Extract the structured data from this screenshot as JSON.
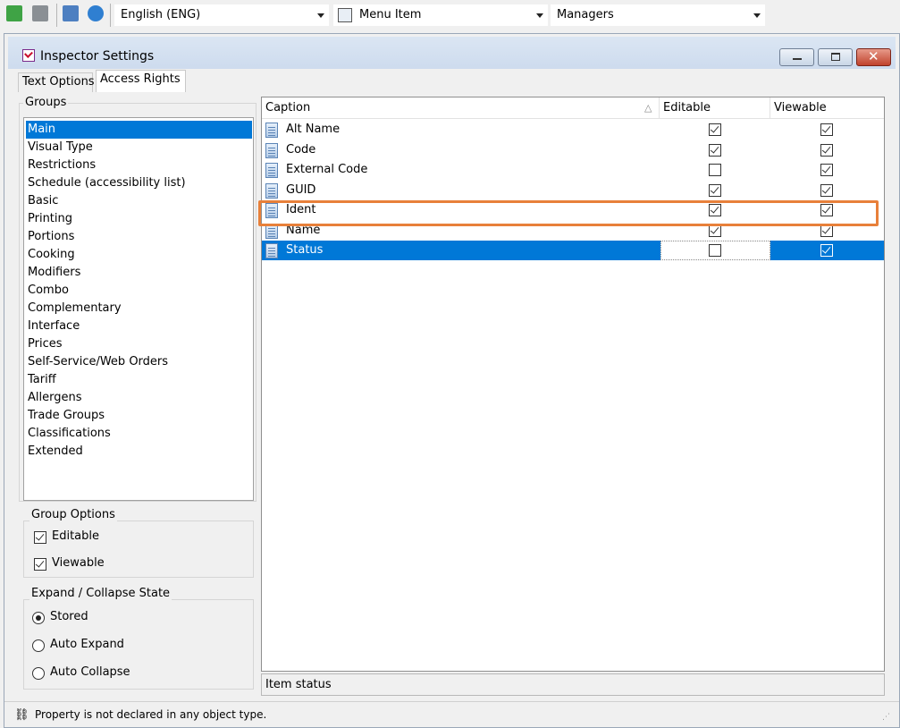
{
  "toolbar": {
    "language": "English (ENG)",
    "object_type": "Menu Item",
    "role": "Managers"
  },
  "window": {
    "title": "Inspector Settings"
  },
  "tabs": [
    "Text Options",
    "Access Rights"
  ],
  "groups": {
    "label": "Groups",
    "items": [
      "Main",
      "Visual Type",
      "Restrictions",
      "Schedule (accessibility list)",
      "Basic",
      "Printing",
      "Portions",
      "Cooking",
      "Modifiers",
      "Combo",
      "Complementary",
      "Interface",
      "Prices",
      "Self-Service/Web Orders",
      "Tariff",
      "Allergens",
      "Trade Groups",
      "Classifications",
      "Extended"
    ],
    "selected": "Main"
  },
  "group_options": {
    "label": "Group Options",
    "editable_label": "Editable",
    "viewable_label": "Viewable",
    "editable_checked": true,
    "viewable_checked": true
  },
  "expand_state": {
    "label": "Expand / Collapse State",
    "options": [
      "Stored",
      "Auto Expand",
      "Auto Collapse"
    ],
    "selected": "Stored"
  },
  "grid": {
    "columns": {
      "caption": "Caption",
      "editable": "Editable",
      "viewable": "Viewable"
    },
    "rows": [
      {
        "caption": "Alt Name",
        "editable": true,
        "viewable": true
      },
      {
        "caption": "Code",
        "editable": true,
        "viewable": true
      },
      {
        "caption": "External Code",
        "editable": false,
        "viewable": true
      },
      {
        "caption": "GUID",
        "editable": true,
        "viewable": true
      },
      {
        "caption": "Ident",
        "editable": true,
        "viewable": true
      },
      {
        "caption": "Name",
        "editable": true,
        "viewable": true
      },
      {
        "caption": "Status",
        "editable": false,
        "viewable": true
      }
    ],
    "selected_row": "Status"
  },
  "description": "Item status",
  "statusbar": {
    "text": "Property is not declared in any object type."
  },
  "colors": {
    "selection": "#0078d7",
    "highlight": "#e8803a"
  }
}
